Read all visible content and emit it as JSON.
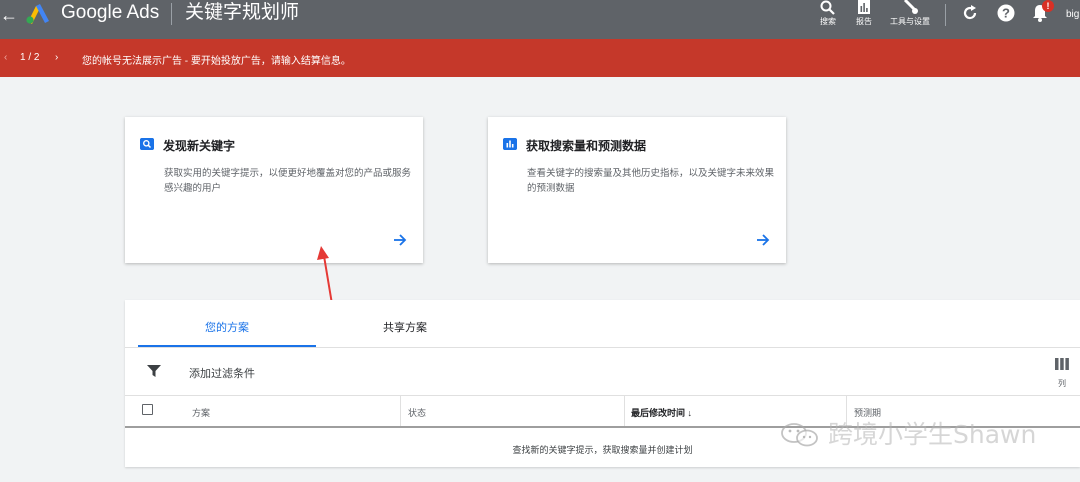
{
  "header": {
    "back_glyph": "←",
    "brand": "Google Ads",
    "page_title": "关键字规划师",
    "buttons": [
      {
        "label": "搜索",
        "icon": "search-icon"
      },
      {
        "label": "报告",
        "icon": "reports-icon"
      },
      {
        "label": "工具与设置",
        "icon": "tools-icon"
      }
    ],
    "icons": [
      "refresh-icon",
      "help-icon",
      "notifications-icon"
    ],
    "notification_badge": "!",
    "user": "big"
  },
  "alert": {
    "prev_glyph": "‹",
    "pager": "1 / 2",
    "next_glyph": "›",
    "message": "您的帐号无法展示广告 - 要开始投放广告，请输入结算信息。"
  },
  "cards": [
    {
      "title": "发现新关键字",
      "description": "获取实用的关键字提示，以便更好地覆盖对您的产品或服务感兴趣的用户",
      "icon": "search-icon"
    },
    {
      "title": "获取搜索量和预测数据",
      "description": "查看关键字的搜索量及其他历史指标，以及关键字未来效果的预测数据",
      "icon": "bar-chart-icon"
    }
  ],
  "plans": {
    "tabs": [
      {
        "label": "您的方案",
        "active": true
      },
      {
        "label": "共享方案",
        "active": false
      }
    ],
    "filter_label": "添加过滤条件",
    "columns_label": "列",
    "table_headers": [
      "方案",
      "状态",
      "最后修改时间 ↓",
      "预测期"
    ],
    "empty_message": "查找新的关键字提示，获取搜索量并创建计划"
  },
  "watermark": {
    "text": "跨境小学生Shawn"
  },
  "colors": {
    "header_bg": "#5f6368",
    "alert_bg": "#c5382a",
    "accent": "#1a73e8",
    "annotation": "#e53935"
  }
}
